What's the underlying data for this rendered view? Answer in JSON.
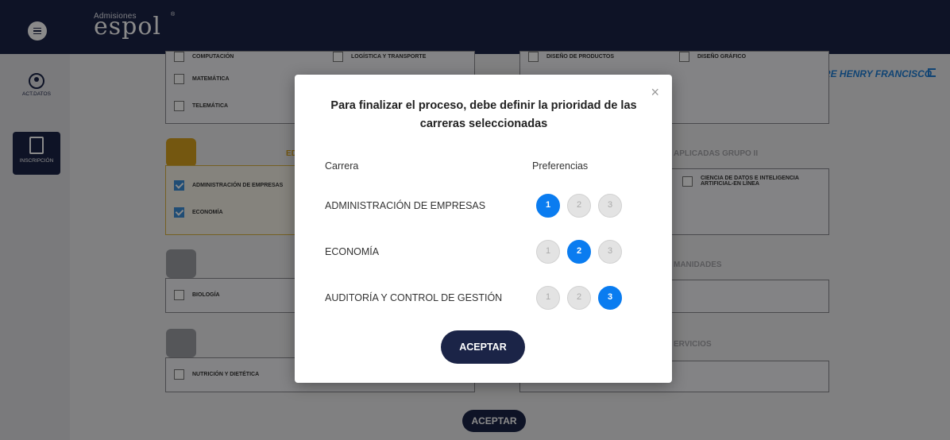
{
  "header": {
    "brand_small": "Admisiones",
    "brand_big": "espol",
    "brand_reg": "®"
  },
  "sidebar": {
    "items": [
      {
        "label": "ACT.DATOS",
        "icon": "user-edit-icon"
      },
      {
        "label": "INSCRIPCIÓN",
        "icon": "clipboard-edit-icon"
      }
    ]
  },
  "user": {
    "name": "ACEVEDO AGUIRRE HENRY FRANCISCO"
  },
  "background": {
    "top_rows": [
      "COMPUTACIÓN",
      "LOGÍSTICA Y TRANSPORTE",
      "DISEÑO DE PRODUCTOS",
      "DISEÑO GRÁFICO",
      "MATEMÁTICA",
      "TELEMÁTICA"
    ],
    "group_ed": "ED",
    "group_aplicadas": "APLICADAS GRUPO II",
    "group_humanidades": "MANIDADES",
    "group_servicios": "ERVICIOS",
    "items_ed": [
      "ADMINISTRACIÓN DE EMPRESAS",
      "ECONOMÍA"
    ],
    "item_ciencia": "CIENCIA DE DATOS E INTELIGENCIA ARTIFICIAL-EN LÍNEA",
    "item_bio": "BIOLOGÍA",
    "item_nutri": "NUTRICIÓN Y DIETÉTICA",
    "accept_label": "ACEPTAR"
  },
  "modal": {
    "title": "Para finalizar el proceso, debe definir la prioridad de las carreras seleccionadas",
    "close": "×",
    "col_carrera": "Carrera",
    "col_pref": "Preferencias",
    "rows": [
      {
        "name": "ADMINISTRACIÓN DE EMPRESAS",
        "selected": 1
      },
      {
        "name": "ECONOMÍA",
        "selected": 2
      },
      {
        "name": "AUDITORÍA Y CONTROL DE GESTIÓN",
        "selected": 3
      }
    ],
    "pref_labels": [
      "1",
      "2",
      "3"
    ],
    "accept_label": "ACEPTAR"
  }
}
